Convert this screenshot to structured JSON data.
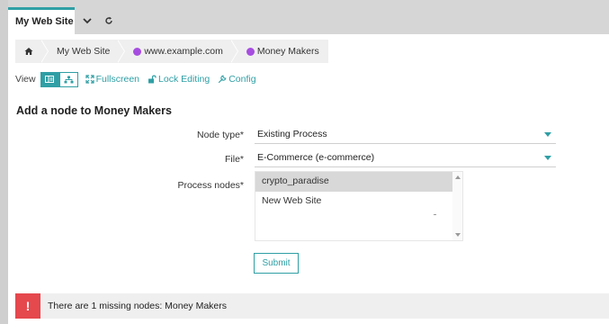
{
  "tabs": {
    "active_label": "My Web Site"
  },
  "breadcrumb": {
    "items": [
      {
        "label": "My Web Site"
      },
      {
        "label": "www.example.com"
      },
      {
        "label": "Money Makers"
      }
    ]
  },
  "toolbar": {
    "view_label": "View",
    "fullscreen_label": "Fullscreen",
    "lock_label": "Lock Editing",
    "config_label": "Config"
  },
  "form": {
    "heading": "Add a node to Money Makers",
    "node_type": {
      "label": "Node type*",
      "value": "Existing Process"
    },
    "file": {
      "label": "File*",
      "value": "E-Commerce (e-commerce)"
    },
    "process_nodes": {
      "label": "Process nodes*",
      "options": [
        {
          "label": "crypto_paradise",
          "selected": true
        },
        {
          "label": "New Web Site",
          "selected": false
        }
      ]
    },
    "submit_label": "Submit"
  },
  "alert": {
    "icon": "!",
    "message": "There are 1 missing nodes: Money Makers"
  },
  "colors": {
    "accent": "#2f9fa5",
    "node_dot": "#a64de0",
    "alert": "#e5484d"
  }
}
